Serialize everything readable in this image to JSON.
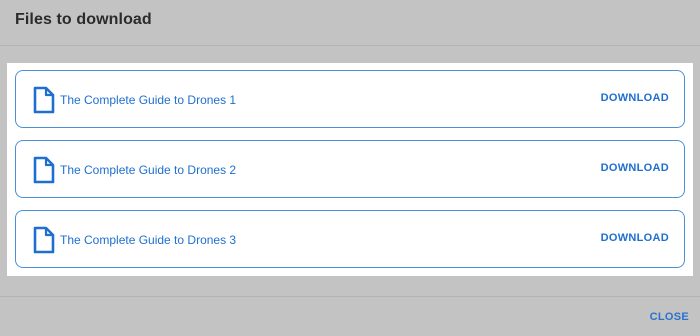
{
  "dialog": {
    "title": "Files to download",
    "close_label": "CLOSE"
  },
  "files": [
    {
      "name": "The Complete Guide to Drones 1",
      "action_label": "DOWNLOAD",
      "icon": "file-icon"
    },
    {
      "name": "The Complete Guide to Drones 2",
      "action_label": "DOWNLOAD",
      "icon": "file-icon"
    },
    {
      "name": "The Complete Guide to Drones 3",
      "action_label": "DOWNLOAD",
      "icon": "file-icon"
    }
  ],
  "colors": {
    "accent": "#1e6fd0",
    "border": "#4a90d9",
    "backdrop": "#c3c3c3",
    "panel": "#ffffff"
  }
}
